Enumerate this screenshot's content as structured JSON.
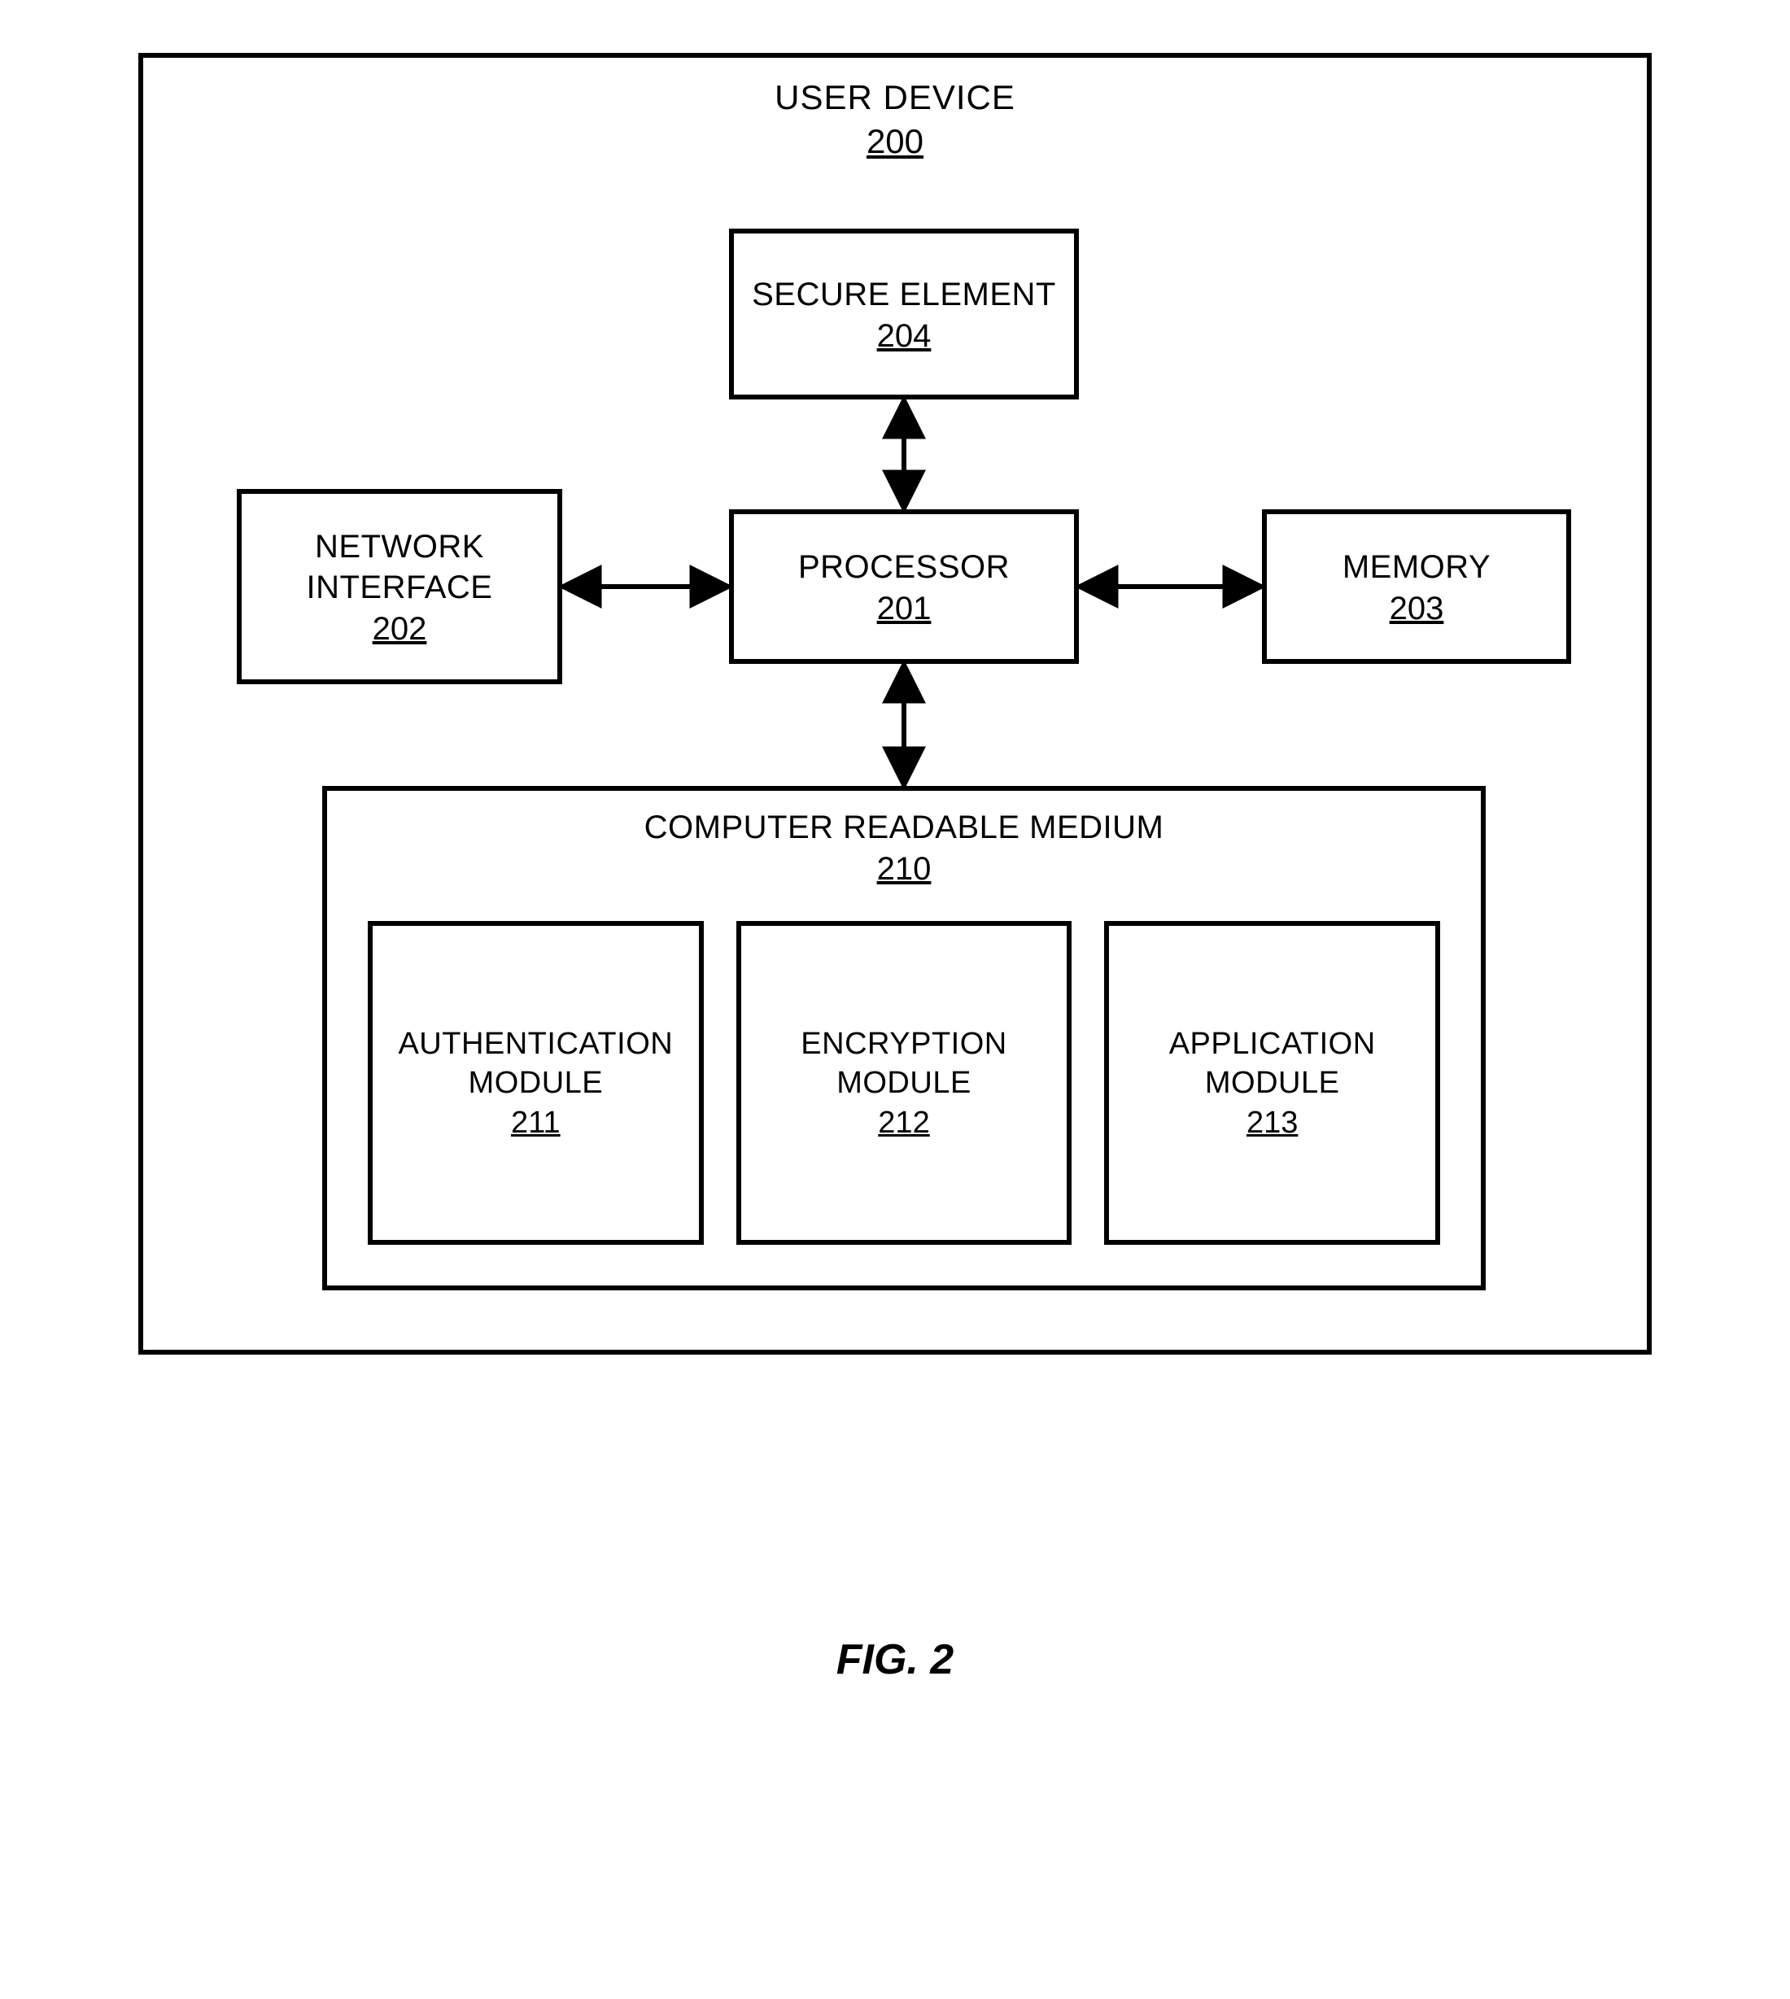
{
  "container": {
    "label": "USER DEVICE",
    "num": "200"
  },
  "secure": {
    "label": "SECURE ELEMENT",
    "num": "204"
  },
  "processor": {
    "label": "PROCESSOR",
    "num": "201"
  },
  "netif": {
    "label_line1": "NETWORK",
    "label_line2": "INTERFACE",
    "num": "202"
  },
  "memory": {
    "label": "MEMORY",
    "num": "203"
  },
  "crm": {
    "label": "COMPUTER READABLE MEDIUM",
    "num": "210"
  },
  "mod1": {
    "label_line1": "AUTHENTICATION",
    "label_line2": "MODULE",
    "num": "211"
  },
  "mod2": {
    "label_line1": "ENCRYPTION",
    "label_line2": "MODULE",
    "num": "212"
  },
  "mod3": {
    "label_line1": "APPLICATION",
    "label_line2": "MODULE",
    "num": "213"
  },
  "figure_caption": "FIG. 2"
}
